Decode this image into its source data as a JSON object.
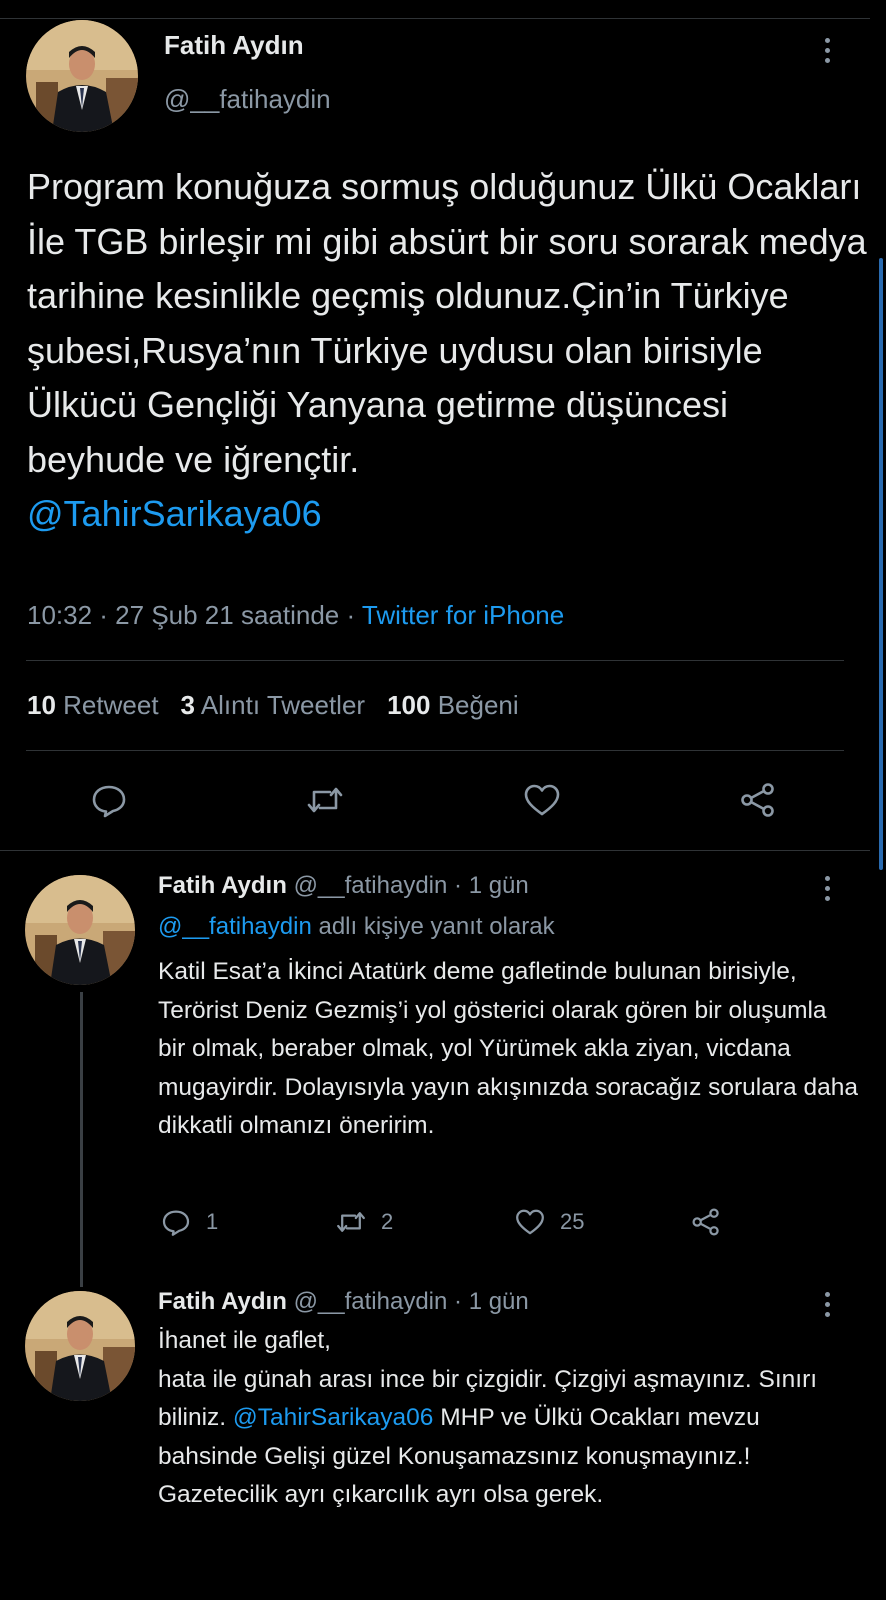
{
  "colors": {
    "background": "#000000",
    "link": "#1d9bf0",
    "muted": "#8b98a5",
    "text": "#e7e9ea"
  },
  "main_tweet": {
    "name": "Fatih Aydın",
    "handle": "@__fatihaydin",
    "text_before": "Program konuğuza sormuş olduğunuz Ülkü Ocakları İle TGB birleşir mi gibi absürt bir soru sorarak medya tarihine kesinlikle geçmiş oldunuz.Çin’in Türkiye şubesi,Rusya’nın Türkiye uydusu olan birisiyle Ülkücü Gençliği Yanyana getirme düşüncesi beyhude ve iğrençtir.",
    "mention": "@TahirSarikaya06",
    "time": "10:32 · 27 Şub 21 saatinde · ",
    "source": "Twitter for iPhone",
    "retweets_count": "10",
    "retweets_label": "Retweet",
    "quotes_count": "3",
    "quotes_label": "Alıntı Tweetler",
    "likes_count": "100",
    "likes_label": "Beğeni",
    "icons": [
      "reply-icon",
      "retweet-icon",
      "like-icon",
      "share-icon"
    ]
  },
  "replies": [
    {
      "name": "Fatih Aydın",
      "handle_time": "@__fatihaydin · 1 gün",
      "reply_to_handle": "@__fatihaydin",
      "reply_to_suffix": " adlı kişiye yanıt olarak",
      "text": "Katil Esat’a İkinci Atatürk deme gafletinde bulunan birisiyle, Terörist Deniz Gezmiş’i yol gösterici olarak gören bir oluşumla bir olmak, beraber olmak, yol Yürümek akla ziyan, vicdana mugayirdir. Dolayısıyla yayın akışınızda soracağız sorulara daha dikkatli olmanızı öneririm.",
      "reply_count": "1",
      "retweet_count": "2",
      "like_count": "25"
    },
    {
      "name": "Fatih Aydın",
      "handle_time": "@__fatihaydin · 1 gün",
      "text_before": "İhanet ile gaflet,\nhata ile günah arası ince bir çizgidir. Çizgiyi aşmayınız. Sınırı biliniz. ",
      "mention": "@TahirSarikaya06",
      "text_after": " MHP ve Ülkü Ocakları mevzu bahsinde Gelişi güzel Konuşamazsınız konuşmayınız.! Gazetecilik ayrı çıkarcılık ayrı olsa gerek."
    }
  ]
}
